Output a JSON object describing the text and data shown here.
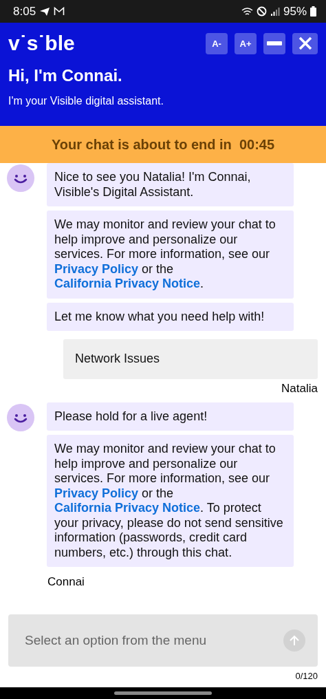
{
  "status_bar": {
    "time": "8:05",
    "battery": "95%"
  },
  "header": {
    "logo": "v˙s˙ble",
    "buttons": [
      {
        "kind": "text",
        "label": "A-"
      },
      {
        "kind": "text",
        "label": "A+"
      },
      {
        "kind": "minimize"
      },
      {
        "kind": "close"
      }
    ],
    "title": "Hi, I'm Connai.",
    "subtitle": "I'm your Visible digital assistant."
  },
  "banner": {
    "text": "Your chat is about to end in  00:45"
  },
  "messages": [
    {
      "kind": "bot",
      "bubbles": [
        [
          {
            "kind": "text",
            "text": "Nice to see you Natalia! I'm Connai, Visible's Digital Assistant."
          }
        ],
        [
          {
            "kind": "text",
            "text": "We may monitor and review your chat to help improve and personalize our services. For more information, see our "
          },
          {
            "kind": "link",
            "text": "Privacy Policy"
          },
          {
            "kind": "text",
            "text": " or the "
          },
          {
            "kind": "link",
            "text": "California Privacy Notice"
          },
          {
            "kind": "text",
            "text": "."
          }
        ],
        [
          {
            "kind": "text",
            "text": "Let me know what you need help with!"
          }
        ]
      ]
    },
    {
      "kind": "user",
      "bubbles": [
        [
          {
            "kind": "text",
            "text": "Network Issues"
          }
        ]
      ],
      "sender": "Natalia"
    },
    {
      "kind": "bot",
      "bubbles": [
        [
          {
            "kind": "text",
            "text": "Please hold for a live agent!"
          }
        ],
        [
          {
            "kind": "text",
            "text": "We may monitor and review your chat to help improve and personalize our services. For more information, see our "
          },
          {
            "kind": "link",
            "text": "Privacy Policy"
          },
          {
            "kind": "text",
            "text": " or the "
          },
          {
            "kind": "link",
            "text": "California Privacy Notice"
          },
          {
            "kind": "text",
            "text": ". To protect your privacy, please do not send sensitive information (passwords, credit card numbers, etc.) through this chat."
          }
        ]
      ],
      "sender": "Connai"
    }
  ],
  "composer": {
    "placeholder": "Select an option from the menu",
    "counter": "0/120"
  }
}
